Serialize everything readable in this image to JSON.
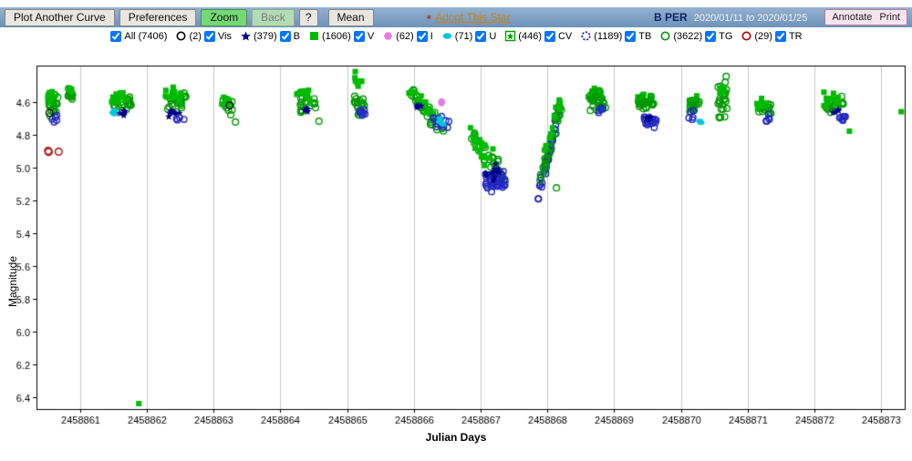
{
  "toolbar": {
    "plot_another_curve": "Plot Another Curve",
    "preferences": "Preferences",
    "zoom": "Zoom",
    "back": "Back",
    "help": "?",
    "mean": "Mean",
    "adopt_this_star": "Adopt This Star",
    "star_name": "B PER",
    "date_range": {
      "from": "2020/01/11",
      "to_word": "to",
      "to": "2020/01/25"
    },
    "annotate": "Annotate",
    "print": "Print"
  },
  "legend": {
    "all": {
      "label": "All",
      "count": "(7406)",
      "checked": true
    },
    "items": [
      {
        "id": "Vis",
        "label": "Vis",
        "count": "(2)",
        "checked": true,
        "shape": "circle-open",
        "color": "#000000"
      },
      {
        "id": "B",
        "label": "B",
        "count": "(379)",
        "checked": true,
        "shape": "star",
        "color": "#00008b"
      },
      {
        "id": "V",
        "label": "V",
        "count": "(1606)",
        "checked": true,
        "shape": "square",
        "color": "#00bb00"
      },
      {
        "id": "I",
        "label": "I",
        "count": "(62)",
        "checked": true,
        "shape": "hexagon",
        "color": "#e878e8"
      },
      {
        "id": "U",
        "label": "U",
        "count": "(71)",
        "checked": true,
        "shape": "ellipse",
        "color": "#00c8d8"
      },
      {
        "id": "CV",
        "label": "CV",
        "count": "(446)",
        "checked": true,
        "shape": "star-square",
        "color": "#00a000"
      },
      {
        "id": "TB",
        "label": "TB",
        "count": "(1189)",
        "checked": true,
        "shape": "circle-dashed",
        "color": "#2228c0"
      },
      {
        "id": "TG",
        "label": "TG",
        "count": "(3622)",
        "checked": true,
        "shape": "circle-open",
        "color": "#009900"
      },
      {
        "id": "TR",
        "label": "TR",
        "count": "(29)",
        "checked": true,
        "shape": "circle-open",
        "color": "#b00000"
      }
    ]
  },
  "chart_data": {
    "type": "scatter",
    "title": "",
    "xlabel": "Julian Days",
    "ylabel": "Magnitude",
    "xlim": [
      2458860.35,
      2458873.35
    ],
    "ylim": [
      4.38,
      6.47
    ],
    "y_inverted_magnitude": true,
    "grid": "vertical-only",
    "x_ticks": [
      2458861,
      2458862,
      2458863,
      2458864,
      2458865,
      2458866,
      2458867,
      2458868,
      2458869,
      2458870,
      2458871,
      2458872,
      2458873
    ],
    "y_ticks": [
      4.6,
      4.8,
      5.0,
      5.2,
      5.4,
      5.6,
      5.8,
      6.0,
      6.2,
      6.4
    ],
    "series_counts": {
      "All": 7406,
      "Vis": 2,
      "B": 379,
      "V": 1606,
      "I": 62,
      "U": 71,
      "CV": 446,
      "TB": 1189,
      "TG": 3622,
      "TR": 29
    },
    "bands": {
      "Vis": {
        "shape": "circle-open",
        "color": "#000000",
        "r": 3.8
      },
      "B": {
        "shape": "star",
        "color": "#00008b",
        "r": 4.2
      },
      "V": {
        "shape": "square",
        "color": "#00bb00",
        "r": 3.0
      },
      "I": {
        "shape": "hexagon",
        "color": "#e878e8",
        "r": 4.0
      },
      "U": {
        "shape": "ellipse",
        "color": "#00c8d8",
        "r": 4.0
      },
      "CV": {
        "shape": "star-open",
        "color": "#00a000",
        "r": 4.0
      },
      "TB": {
        "shape": "circle-open",
        "color": "#2228c0",
        "r": 3.2
      },
      "TG": {
        "shape": "circle-open",
        "color": "#009900",
        "r": 3.4
      },
      "TR": {
        "shape": "circle-open",
        "color": "#b00000",
        "r": 3.8
      }
    },
    "clusters": [
      {
        "b": "TG",
        "x": 2458860.6,
        "dx": 0.14,
        "m": 4.62,
        "dm": 0.09,
        "n": 22
      },
      {
        "b": "V",
        "x": 2458860.57,
        "dx": 0.1,
        "m": 4.58,
        "dm": 0.05,
        "n": 10
      },
      {
        "b": "TG",
        "x": 2458860.85,
        "dx": 0.08,
        "m": 4.56,
        "dm": 0.07,
        "n": 14
      },
      {
        "b": "V",
        "x": 2458860.86,
        "dx": 0.06,
        "m": 4.52,
        "dm": 0.03,
        "n": 6
      },
      {
        "b": "TB",
        "x": 2458860.63,
        "dx": 0.1,
        "m": 4.7,
        "dm": 0.03,
        "n": 5
      },
      {
        "b": "TR",
        "x": 2458860.6,
        "dx": 0.18,
        "m": 4.9,
        "dm": 0.02,
        "n": 3
      },
      {
        "b": "Vis",
        "x": 2458860.55,
        "dx": 0.02,
        "m": 4.66,
        "dm": 0.01,
        "n": 1
      },
      {
        "b": "TG",
        "x": 2458861.62,
        "dx": 0.3,
        "m": 4.6,
        "dm": 0.07,
        "n": 22
      },
      {
        "b": "V",
        "x": 2458861.6,
        "dx": 0.28,
        "m": 4.58,
        "dm": 0.05,
        "n": 14
      },
      {
        "b": "U",
        "x": 2458861.5,
        "dx": 0.06,
        "m": 4.66,
        "dm": 0.02,
        "n": 4
      },
      {
        "b": "B",
        "x": 2458861.62,
        "dx": 0.15,
        "m": 4.67,
        "dm": 0.03,
        "n": 5
      },
      {
        "b": "V",
        "x": 2458861.88,
        "dx": 0.01,
        "m": 6.44,
        "dm": 0.005,
        "n": 1
      },
      {
        "b": "TG",
        "x": 2458862.45,
        "dx": 0.28,
        "m": 4.6,
        "dm": 0.08,
        "n": 26
      },
      {
        "b": "V",
        "x": 2458862.4,
        "dx": 0.25,
        "m": 4.56,
        "dm": 0.05,
        "n": 16
      },
      {
        "b": "B",
        "x": 2458862.42,
        "dx": 0.18,
        "m": 4.67,
        "dm": 0.03,
        "n": 8
      },
      {
        "b": "TB",
        "x": 2458862.5,
        "dx": 0.12,
        "m": 4.7,
        "dm": 0.02,
        "n": 4
      },
      {
        "b": "TG",
        "x": 2458863.2,
        "dx": 0.16,
        "m": 4.63,
        "dm": 0.06,
        "n": 12
      },
      {
        "b": "V",
        "x": 2458863.18,
        "dx": 0.12,
        "m": 4.6,
        "dm": 0.04,
        "n": 6
      },
      {
        "b": "Vis",
        "x": 2458863.25,
        "dx": 0.02,
        "m": 4.62,
        "dm": 0.01,
        "n": 1
      },
      {
        "b": "TG",
        "x": 2458863.32,
        "dx": 0.02,
        "m": 4.73,
        "dm": 0.01,
        "n": 1
      },
      {
        "b": "TG",
        "x": 2458864.4,
        "dx": 0.26,
        "m": 4.6,
        "dm": 0.07,
        "n": 20
      },
      {
        "b": "V",
        "x": 2458864.35,
        "dx": 0.22,
        "m": 4.55,
        "dm": 0.05,
        "n": 12
      },
      {
        "b": "B",
        "x": 2458864.4,
        "dx": 0.12,
        "m": 4.66,
        "dm": 0.03,
        "n": 4
      },
      {
        "b": "TG",
        "x": 2458864.58,
        "dx": 0.02,
        "m": 4.72,
        "dm": 0.01,
        "n": 1
      },
      {
        "b": "V",
        "x": 2458865.15,
        "dx": 0.14,
        "m": 4.48,
        "dm": 0.04,
        "n": 10
      },
      {
        "b": "TG",
        "x": 2458865.18,
        "dx": 0.16,
        "m": 4.62,
        "dm": 0.08,
        "n": 18
      },
      {
        "b": "TB",
        "x": 2458865.22,
        "dx": 0.1,
        "m": 4.68,
        "dm": 0.04,
        "n": 8
      },
      {
        "b": "V",
        "x": 2458865.12,
        "dx": 0.01,
        "m": 4.42,
        "dm": 0.005,
        "n": 1
      },
      {
        "b": "TG",
        "x": 2458866.2,
        "dx": 0.5,
        "m": 4.66,
        "dm": 0.06,
        "n": 30,
        "s": 0.45
      },
      {
        "b": "V",
        "x": 2458866.15,
        "dx": 0.45,
        "m": 4.62,
        "dm": 0.05,
        "n": 18,
        "s": 0.4
      },
      {
        "b": "TB",
        "x": 2458866.4,
        "dx": 0.25,
        "m": 4.72,
        "dm": 0.05,
        "n": 14
      },
      {
        "b": "U",
        "x": 2458866.42,
        "dx": 0.08,
        "m": 4.72,
        "dm": 0.03,
        "n": 4
      },
      {
        "b": "I",
        "x": 2458866.4,
        "dx": 0.04,
        "m": 4.6,
        "dm": 0.01,
        "n": 2
      },
      {
        "b": "B",
        "x": 2458866.05,
        "dx": 0.12,
        "m": 4.63,
        "dm": 0.02,
        "n": 5
      },
      {
        "b": "TG",
        "x": 2458867.1,
        "dx": 0.5,
        "m": 4.93,
        "dm": 0.09,
        "n": 30,
        "s": 0.55
      },
      {
        "b": "V",
        "x": 2458867.05,
        "dx": 0.45,
        "m": 4.9,
        "dm": 0.1,
        "n": 22,
        "s": 0.5
      },
      {
        "b": "TB",
        "x": 2458867.22,
        "dx": 0.3,
        "m": 5.08,
        "dm": 0.09,
        "n": 40
      },
      {
        "b": "B",
        "x": 2458867.18,
        "dx": 0.22,
        "m": 5.03,
        "dm": 0.06,
        "n": 10
      },
      {
        "b": "TB",
        "x": 2458868.02,
        "dx": 0.32,
        "m": 4.92,
        "dm": 0.08,
        "n": 45,
        "s": -1.7
      },
      {
        "b": "TG",
        "x": 2458868.05,
        "dx": 0.32,
        "m": 4.85,
        "dm": 0.07,
        "n": 30,
        "s": -1.5
      },
      {
        "b": "V",
        "x": 2458868.08,
        "dx": 0.26,
        "m": 4.74,
        "dm": 0.06,
        "n": 16,
        "s": -1.2
      },
      {
        "b": "TG",
        "x": 2458868.13,
        "dx": 0.02,
        "m": 5.12,
        "dm": 0.01,
        "n": 1
      },
      {
        "b": "V",
        "x": 2458868.72,
        "dx": 0.22,
        "m": 4.55,
        "dm": 0.05,
        "n": 16
      },
      {
        "b": "TG",
        "x": 2458868.75,
        "dx": 0.24,
        "m": 4.6,
        "dm": 0.07,
        "n": 24
      },
      {
        "b": "TB",
        "x": 2458868.8,
        "dx": 0.1,
        "m": 4.65,
        "dm": 0.03,
        "n": 5
      },
      {
        "b": "V",
        "x": 2458869.45,
        "dx": 0.22,
        "m": 4.58,
        "dm": 0.05,
        "n": 14
      },
      {
        "b": "TG",
        "x": 2458869.48,
        "dx": 0.24,
        "m": 4.62,
        "dm": 0.06,
        "n": 20
      },
      {
        "b": "TB",
        "x": 2458869.55,
        "dx": 0.2,
        "m": 4.72,
        "dm": 0.05,
        "n": 20
      },
      {
        "b": "B",
        "x": 2458869.5,
        "dx": 0.1,
        "m": 4.7,
        "dm": 0.02,
        "n": 5
      },
      {
        "b": "V",
        "x": 2458870.18,
        "dx": 0.14,
        "m": 4.6,
        "dm": 0.04,
        "n": 8
      },
      {
        "b": "TG",
        "x": 2458870.2,
        "dx": 0.16,
        "m": 4.63,
        "dm": 0.06,
        "n": 12
      },
      {
        "b": "TB",
        "x": 2458870.15,
        "dx": 0.08,
        "m": 4.68,
        "dm": 0.03,
        "n": 5
      },
      {
        "b": "U",
        "x": 2458870.28,
        "dx": 0.04,
        "m": 4.72,
        "dm": 0.02,
        "n": 2
      },
      {
        "b": "TG",
        "x": 2458870.62,
        "dx": 0.14,
        "m": 4.58,
        "dm": 0.15,
        "n": 26
      },
      {
        "b": "V",
        "x": 2458870.6,
        "dx": 0.1,
        "m": 4.55,
        "dm": 0.06,
        "n": 6
      },
      {
        "b": "TG",
        "x": 2458871.25,
        "dx": 0.2,
        "m": 4.64,
        "dm": 0.05,
        "n": 16
      },
      {
        "b": "V",
        "x": 2458871.2,
        "dx": 0.16,
        "m": 4.61,
        "dm": 0.04,
        "n": 10
      },
      {
        "b": "TB",
        "x": 2458871.3,
        "dx": 0.1,
        "m": 4.7,
        "dm": 0.03,
        "n": 6
      },
      {
        "b": "TG",
        "x": 2458872.3,
        "dx": 0.26,
        "m": 4.62,
        "dm": 0.06,
        "n": 20
      },
      {
        "b": "V",
        "x": 2458872.25,
        "dx": 0.22,
        "m": 4.58,
        "dm": 0.05,
        "n": 14
      },
      {
        "b": "TB",
        "x": 2458872.4,
        "dx": 0.14,
        "m": 4.7,
        "dm": 0.03,
        "n": 10
      },
      {
        "b": "B",
        "x": 2458872.32,
        "dx": 0.1,
        "m": 4.66,
        "dm": 0.02,
        "n": 4
      },
      {
        "b": "V",
        "x": 2458872.52,
        "dx": 0.01,
        "m": 4.78,
        "dm": 0.005,
        "n": 1
      },
      {
        "b": "V",
        "x": 2458873.3,
        "dx": 0.005,
        "m": 4.66,
        "dm": 0.003,
        "n": 1
      }
    ]
  }
}
